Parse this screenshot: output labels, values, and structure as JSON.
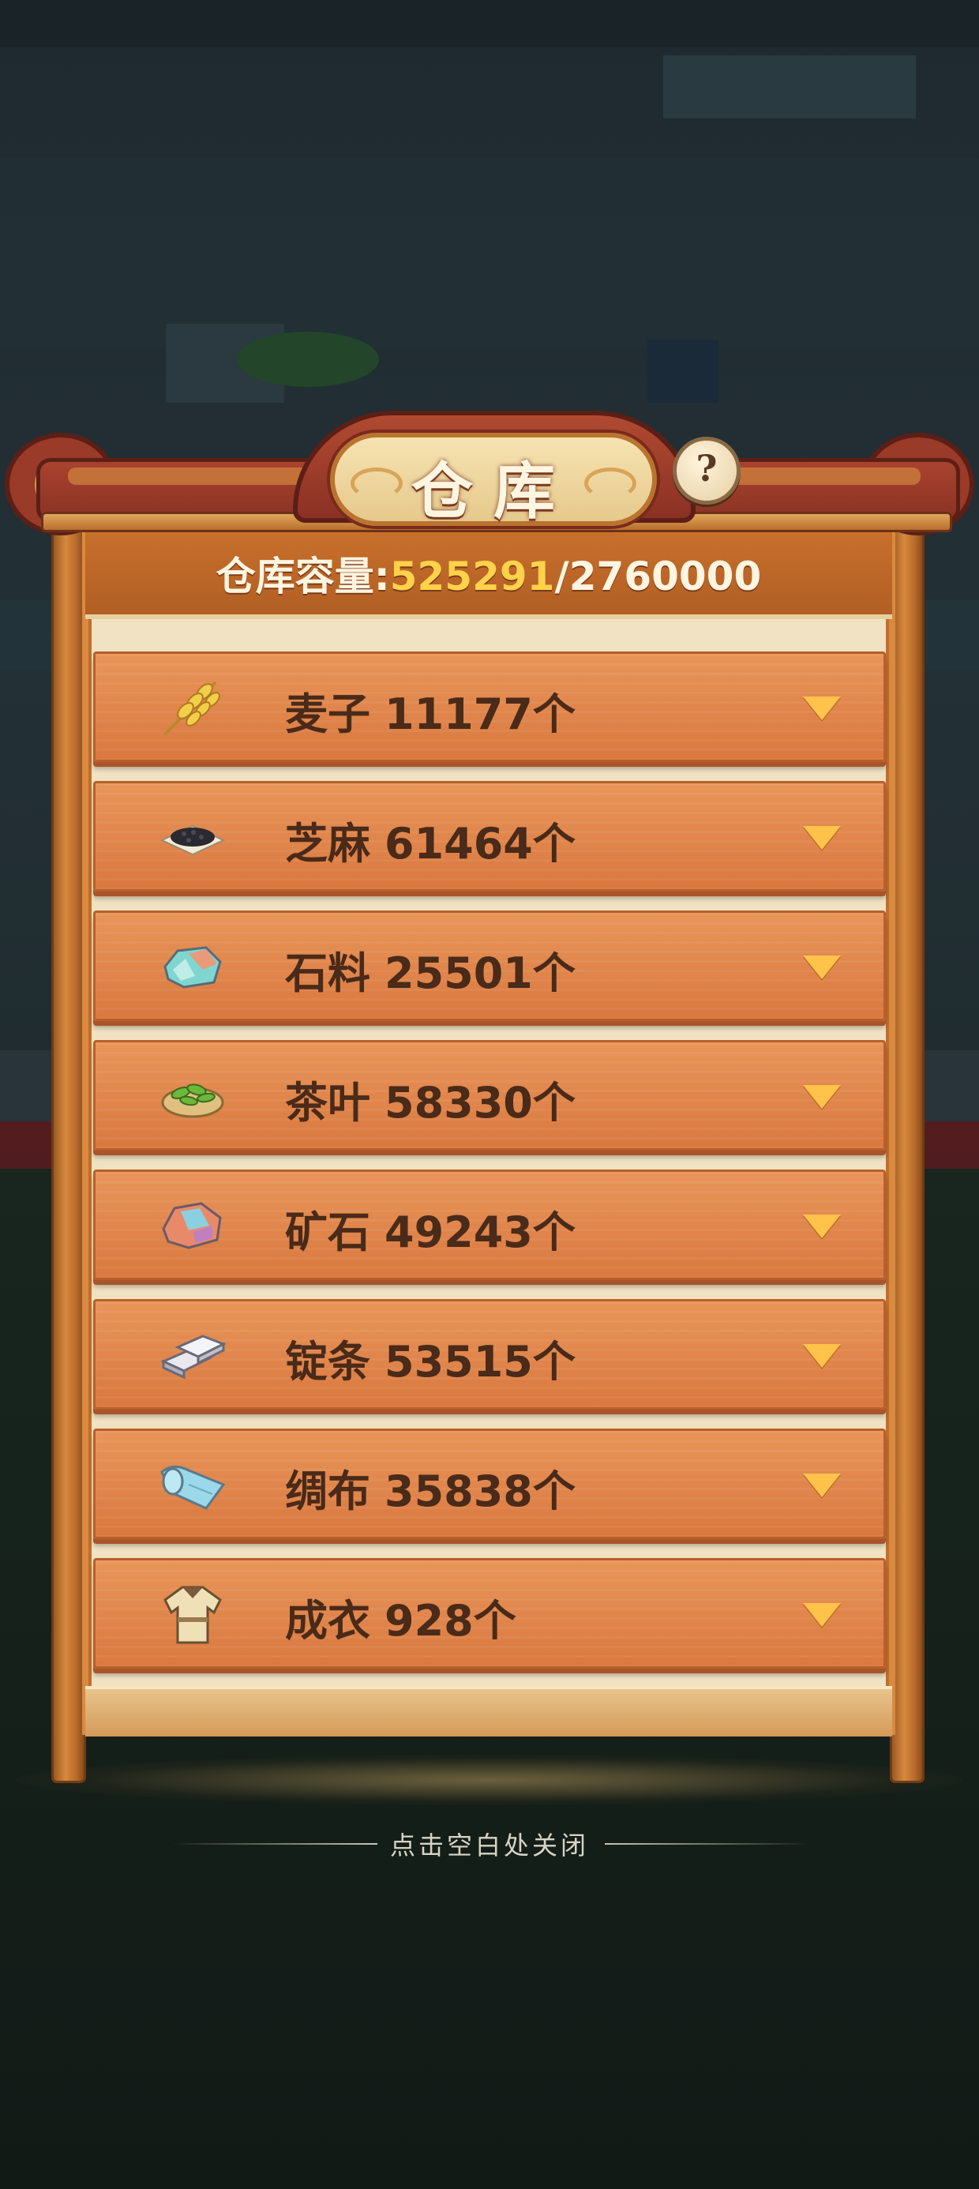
{
  "panel": {
    "title": "仓库",
    "help_symbol": "?",
    "capacity_label": "仓库容量:",
    "capacity_used": "525291",
    "capacity_separator": "/",
    "capacity_total": "2760000"
  },
  "items": [
    {
      "name": "麦子",
      "count": "11177",
      "unit": "个",
      "icon": "wheat-icon"
    },
    {
      "name": "芝麻",
      "count": "61464",
      "unit": "个",
      "icon": "sesame-icon"
    },
    {
      "name": "石料",
      "count": "25501",
      "unit": "个",
      "icon": "stone-icon"
    },
    {
      "name": "茶叶",
      "count": "58330",
      "unit": "个",
      "icon": "tea-leaves-icon"
    },
    {
      "name": "矿石",
      "count": "49243",
      "unit": "个",
      "icon": "ore-icon"
    },
    {
      "name": "锭条",
      "count": "53515",
      "unit": "个",
      "icon": "ingot-icon"
    },
    {
      "name": "绸布",
      "count": "35838",
      "unit": "个",
      "icon": "silk-cloth-icon"
    },
    {
      "name": "成衣",
      "count": "928",
      "unit": "个",
      "icon": "garment-icon"
    }
  ],
  "footer": {
    "close_hint": "点击空白处关闭"
  },
  "colors": {
    "capacity_used": "#ffd24a",
    "row_wood": "#d9783f",
    "chevron": "#ffc24a",
    "title_banner": "#8a3224"
  }
}
